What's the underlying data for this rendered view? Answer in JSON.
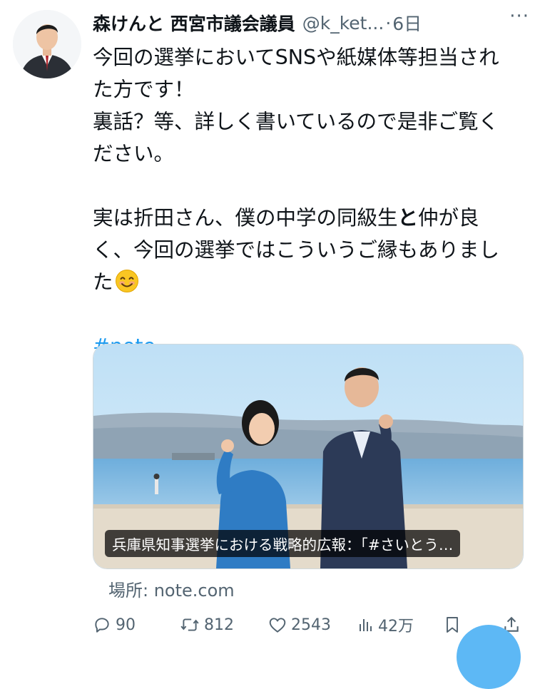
{
  "tweet": {
    "author_name": "森けんと 西宮市議会議員",
    "handle": "@k_ket...",
    "separator": "·",
    "time": "6日",
    "more_label": "···",
    "lines": [
      "今回の選挙においてSNSや紙媒体等担当され",
      "た方です！",
      "裏話？等、詳しく書いているので是非ご覧く",
      "ださい。",
      "",
      "実は折田さん、僕の中学の同級生",
      "く、今回の選挙ではこういうご縁もありまし",
      "た"
    ],
    "line6_strong": "と",
    "line6_tail": "仲が良",
    "emoji": "smiling-face",
    "hashtag": "#note"
  },
  "card": {
    "caption": "兵庫県知事選挙における戦略的広報：「#さいとう…",
    "domain": "場所: note.com"
  },
  "actions": {
    "replies": "90",
    "retweets": "812",
    "likes": "2543",
    "views": "42万"
  },
  "colors": {
    "accent": "#1d9bf0",
    "text": "#0f1419",
    "muted": "#536471"
  }
}
